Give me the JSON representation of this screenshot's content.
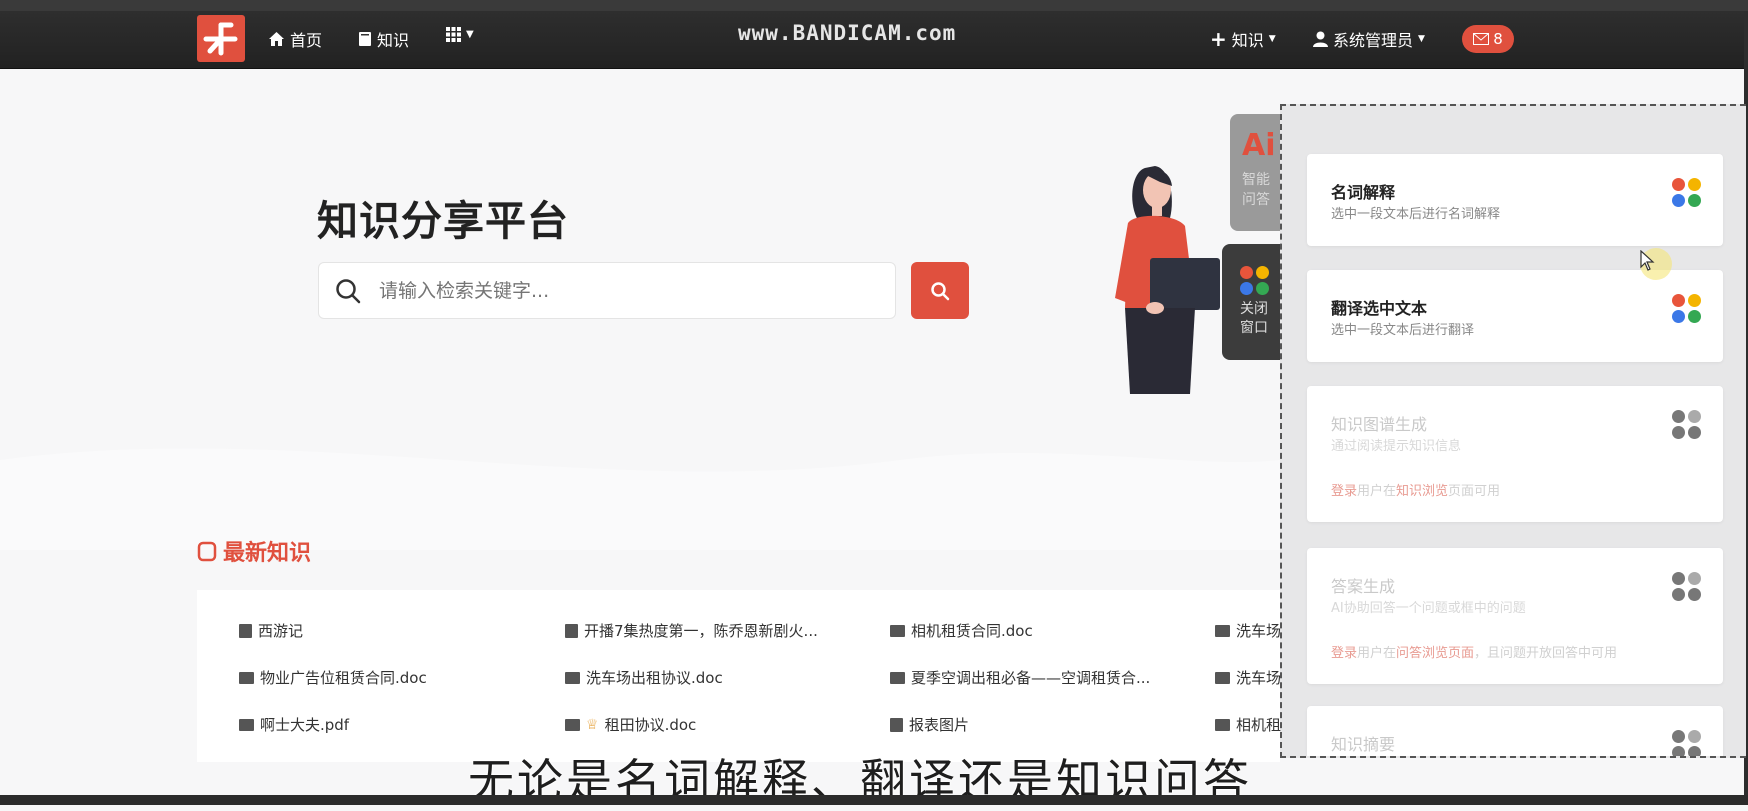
{
  "nav": {
    "home": "首页",
    "knowledge": "知识",
    "add_knowledge": "知识",
    "user": "系统管理员",
    "mail_count": "8",
    "watermark": "www.BANDICAM.com"
  },
  "hero": {
    "title": "知识分享平台",
    "search_placeholder": "请输入检索关键字..."
  },
  "ai_tab": {
    "label": "Ai",
    "sub": "智能问答"
  },
  "close_tab": {
    "label": "关闭窗口"
  },
  "side_panel": {
    "cards": [
      {
        "title": "名词解释",
        "desc": "选中一段文本后进行名词解释",
        "enabled": true
      },
      {
        "title": "翻译选中文本",
        "desc": "选中一段文本后进行翻译",
        "enabled": true
      },
      {
        "title": "知识图谱生成",
        "desc": "通过阅读提示知识信息",
        "enabled": false,
        "note_hl1": "登录",
        "note_mid": "用户在",
        "note_hl2": "知识浏览",
        "note_end": "页面可用"
      },
      {
        "title": "答案生成",
        "desc": "AI协助回答一个问题或框中的问题",
        "enabled": false,
        "note_hl1": "登录",
        "note_mid": "用户在",
        "note_hl2": "问答浏览页面",
        "note_end": "，且问题开放回答中可用"
      },
      {
        "title": "知识摘要",
        "enabled": false
      }
    ]
  },
  "latest": {
    "title": "最新知识",
    "items": [
      [
        "西游记",
        "开播7集热度第一，陈乔恩新剧火...",
        "相机租赁合同.doc",
        "洗车场"
      ],
      [
        "物业广告位租赁合同.doc",
        "洗车场出租协议.doc",
        "夏季空调出租必备——空调租赁合...",
        "洗车场"
      ],
      [
        "啊士大夫.pdf",
        "租田协议.doc",
        "报表图片",
        "相机租"
      ]
    ]
  },
  "subtitle": "无论是名词解释、翻译还是知识问答",
  "colors": {
    "accent": "#e0503e",
    "navbar": "#262626"
  }
}
